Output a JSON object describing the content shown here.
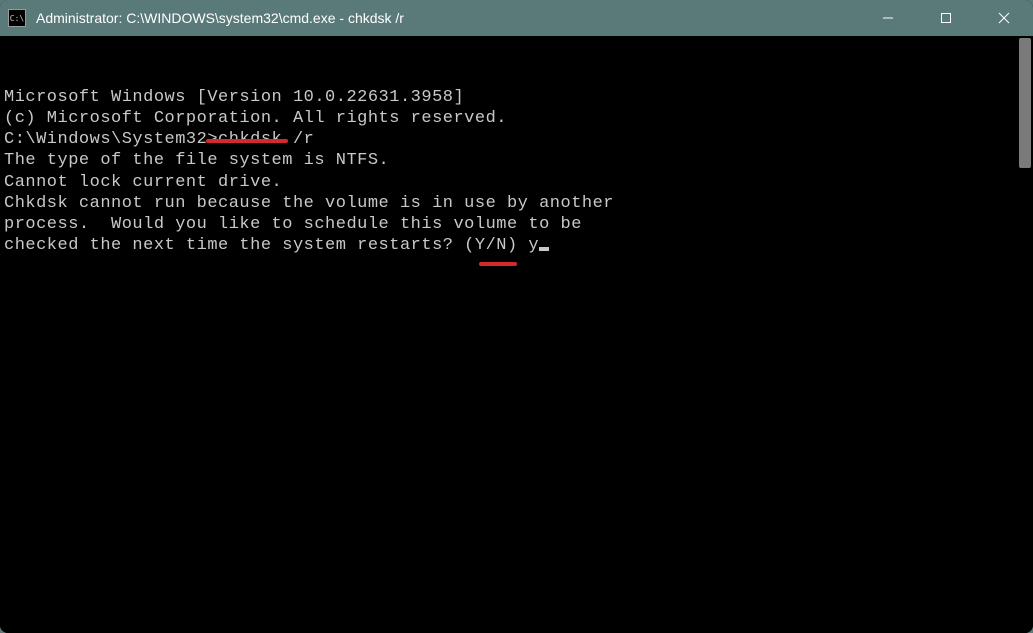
{
  "titlebar": {
    "icon_label": "C:\\",
    "title": "Administrator: C:\\WINDOWS\\system32\\cmd.exe - chkdsk  /r"
  },
  "terminal": {
    "line1": "Microsoft Windows [Version 10.0.22631.3958]",
    "line2": "(c) Microsoft Corporation. All rights reserved.",
    "blank1": "",
    "prompt": "C:\\Windows\\System32>",
    "command": "chkdsk /r",
    "line3": "The type of the file system is NTFS.",
    "line4": "Cannot lock current drive.",
    "blank2": "",
    "line5": "Chkdsk cannot run because the volume is in use by another",
    "line6": "process.  Would you like to schedule this volume to be",
    "line7": "checked the next time the system restarts? (Y/N) ",
    "user_input": "y"
  }
}
